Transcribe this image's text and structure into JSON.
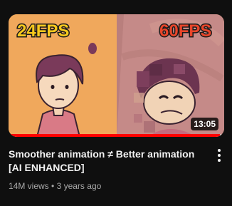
{
  "thumbnail": {
    "left_label": "24FPS",
    "right_label": "60FPS",
    "duration": "13:05",
    "watched_fraction": 0.98,
    "colors": {
      "left_bg": "#f0a85c",
      "right_bg": "#c58a88",
      "label_fill": "#f6c81d",
      "label_fill_right": "#e8452a",
      "progress": "#ff0000"
    }
  },
  "video": {
    "title": "Smoother animation ≠ Better animation [AI ENHANCED]",
    "views": "14M views",
    "separator": "•",
    "age": "3 years ago"
  },
  "menu": {
    "icon": "more-vert-icon"
  }
}
